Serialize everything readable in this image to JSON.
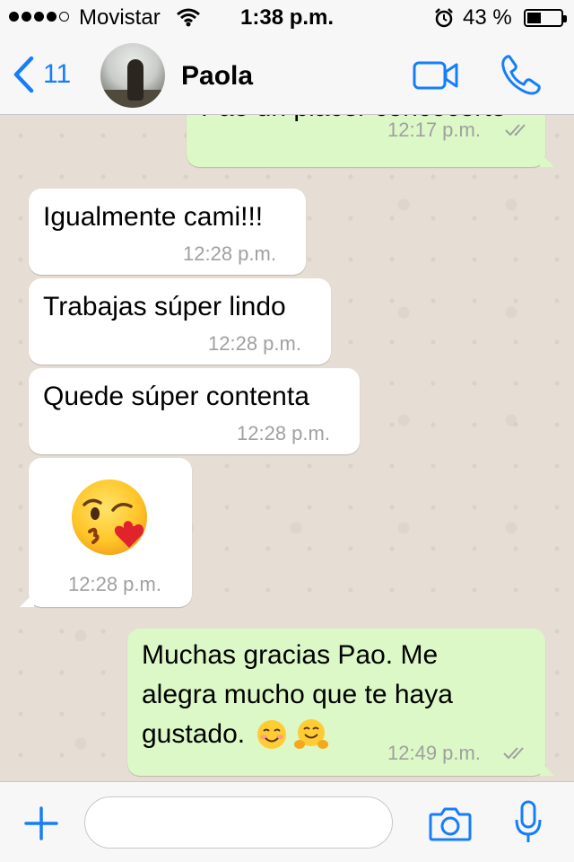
{
  "status_bar": {
    "carrier": "Movistar",
    "time": "1:38 p.m.",
    "battery": "43 %",
    "battery_level": 0.43
  },
  "header": {
    "back_count": "11",
    "contact_name": "Paola"
  },
  "messages": [
    {
      "direction": "outgoing",
      "text": "Pao un placer concocerte",
      "time": "12:17 p.m.",
      "status": "read"
    },
    {
      "direction": "incoming",
      "text": "Igualmente cami!!!",
      "time": "12:28 p.m."
    },
    {
      "direction": "incoming",
      "text": "Trabajas súper lindo",
      "time": "12:28 p.m."
    },
    {
      "direction": "incoming",
      "text": "Quede súper contenta",
      "time": "12:28 p.m."
    },
    {
      "direction": "incoming",
      "emoji": "kissing-face-with-heart",
      "time": "12:28 p.m."
    },
    {
      "direction": "outgoing",
      "lines": [
        "Muchas gracias Pao. Me",
        "alegra mucho que te haya",
        "gustado."
      ],
      "emojis": [
        "smiling-face-blush",
        "hugging-face"
      ],
      "time": "12:49 p.m.",
      "status": "read"
    }
  ],
  "composer": {
    "placeholder": "",
    "value": ""
  },
  "colors": {
    "accent": "#157efb",
    "outgoing_bubble": "#dcf8c6",
    "incoming_bubble": "#ffffff",
    "chat_background": "#e6ddd4"
  },
  "icons": [
    "back-chevron-icon",
    "video-call-icon",
    "phone-icon",
    "plus-icon",
    "camera-icon",
    "microphone-icon",
    "wifi-icon",
    "alarm-icon",
    "battery-icon",
    "double-check-icon"
  ]
}
